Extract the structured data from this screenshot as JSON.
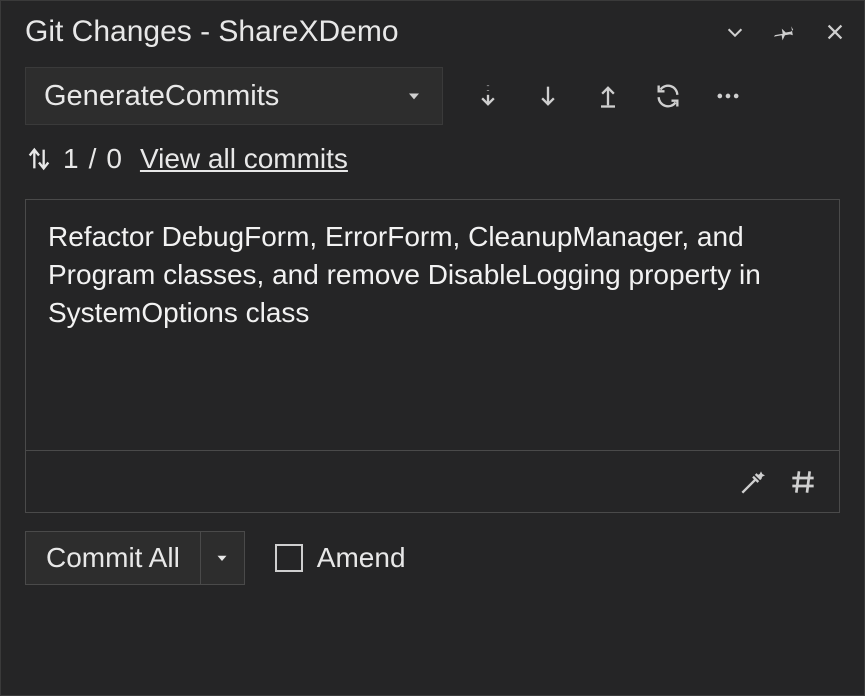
{
  "titlebar": {
    "title": "Git Changes - ShareXDemo"
  },
  "branch": {
    "name": "GenerateCommits"
  },
  "status": {
    "outgoing": "1",
    "incoming": "0",
    "separator": " / ",
    "view_all_label": "View all commits"
  },
  "commit_message": "Refactor DebugForm, ErrorForm, CleanupManager, and Program classes, and remove DisableLogging property in SystemOptions class",
  "actions": {
    "commit_label": "Commit All",
    "amend_label": "Amend"
  }
}
